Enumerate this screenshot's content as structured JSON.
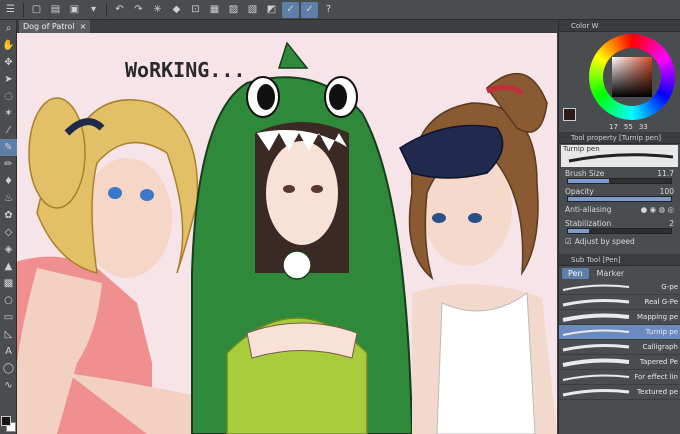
{
  "document": {
    "tab_title": "Dog of Patrol"
  },
  "canvas": {
    "text": "WoRKING..."
  },
  "color_panel": {
    "title": "Color W",
    "values": [
      "17",
      "55",
      "33"
    ]
  },
  "tool_property": {
    "title": "Tool property [Turnip pen]",
    "brush_name": "Turnip pen",
    "brush_size_label": "Brush Size",
    "brush_size_value": "11.7",
    "brush_size_percent": 0.4,
    "opacity_label": "Opacity",
    "opacity_value": "100",
    "opacity_percent": 1.0,
    "antialias_label": "Anti-aliasing",
    "stabilization_label": "Stabilization",
    "stabilization_value": "2",
    "stabilization_percent": 0.2,
    "adjust_label": "Adjust by speed"
  },
  "sub_tool": {
    "title": "Sub Tool [Pen]",
    "tabs": [
      "Pen",
      "Marker"
    ],
    "brushes": [
      "G-pe",
      "Real G-Pe",
      "Mapping pe",
      "Turnip pe",
      "Calligraph",
      "Tapered Pe",
      "For effect lin",
      "Textured pe"
    ]
  },
  "colors": {
    "accent": "#5e7fa8",
    "canvas_bg": "#f7e4e9",
    "dino_green": "#2e8a3a"
  }
}
